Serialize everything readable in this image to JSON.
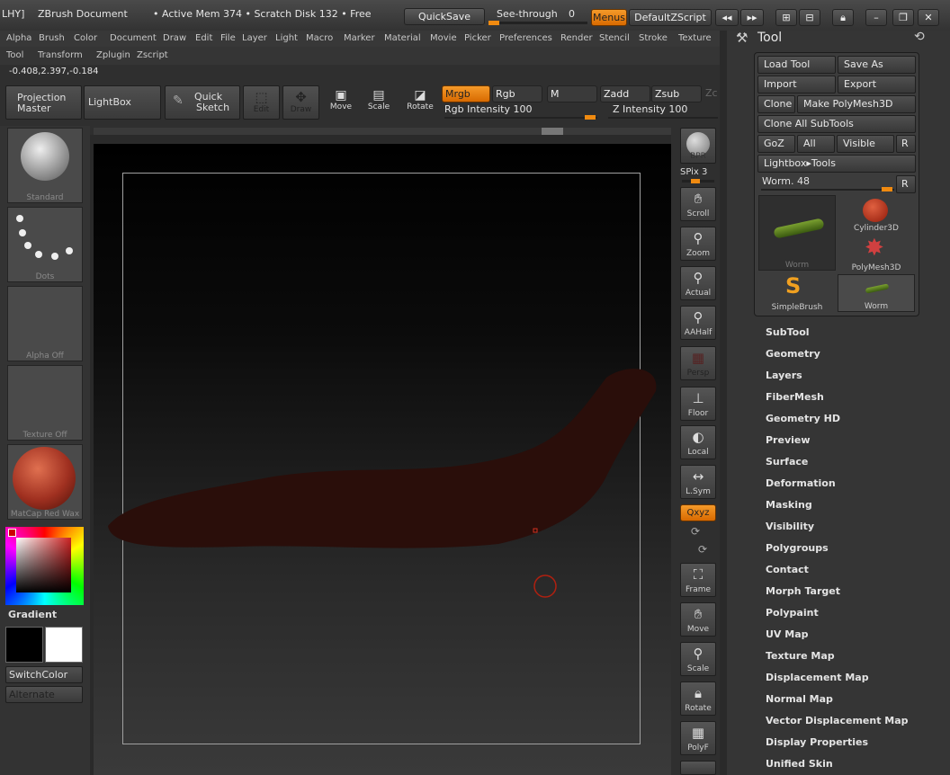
{
  "titlebar": {
    "app": "LHY]",
    "doc": "ZBrush Document",
    "mem": "• Active Mem 374 • Scratch Disk 132 • Free",
    "quicksave": "QuickSave",
    "seethrough": "See-through",
    "seethrough_val": "0",
    "menus": "Menus",
    "script": "DefaultZScript"
  },
  "menu1": [
    "Alpha",
    "Brush",
    "Color",
    "Document",
    "Draw",
    "Edit",
    "File",
    "Layer",
    "Light",
    "Macro",
    "Marker",
    "Material",
    "Movie",
    "Picker",
    "Preferences",
    "Render",
    "Stencil",
    "Stroke",
    "Texture"
  ],
  "menu2": [
    "Tool",
    "Transform",
    "Zplugin",
    "Zscript"
  ],
  "coords": "-0.408,2.397,-0.184",
  "shelf": {
    "projection": "Projection Master",
    "lightbox": "LightBox",
    "quick1": "Quick",
    "quick2": "Sketch",
    "edit": "Edit",
    "draw": "Draw",
    "move": "Move",
    "scale": "Scale",
    "rotate": "Rotate",
    "mrgb": "Mrgb",
    "rgb": "Rgb",
    "m": "M",
    "zadd": "Zadd",
    "zsub": "Zsub",
    "zc": "Zc",
    "rgb_int_label": "Rgb Intensity",
    "rgb_int": "100",
    "z_int_label": "Z Intensity",
    "z_int": "100"
  },
  "left": {
    "brush": "Standard",
    "stroke": "Dots",
    "alpha": "Alpha Off",
    "texture": "Texture Off",
    "material": "MatCap Red Wax",
    "gradient": "Gradient",
    "switch": "SwitchColor",
    "alternate": "Alternate"
  },
  "right_tools": {
    "bpr": "BPR",
    "spix": "SPix 3",
    "scroll": "Scroll",
    "zoom": "Zoom",
    "actual": "Actual",
    "aahalf": "AAHalf",
    "persp": "Persp",
    "floor": "Floor",
    "local": "Local",
    "lsym": "L.Sym",
    "xyz": "Qxyz",
    "frame": "Frame",
    "move": "Move",
    "scale": "Scale",
    "rotate": "Rotate",
    "polyf": "PolyF"
  },
  "tool_panel": {
    "title": "Tool",
    "load": "Load Tool",
    "saveas": "Save As",
    "import": "Import",
    "export": "Export",
    "clone": "Clone",
    "make": "Make PolyMesh3D",
    "cloneall": "Clone All SubTools",
    "goz": "GoZ",
    "all": "All",
    "visible": "Visible",
    "r": "R",
    "lightbox": "Lightbox▸Tools",
    "worm_label": "Worm.",
    "worm_val": "48",
    "r2": "R",
    "thumbs": [
      "Worm",
      "Cylinder3D",
      "PolyMesh3D",
      "SimpleBrush",
      "Worm"
    ]
  },
  "sections": [
    "SubTool",
    "Geometry",
    "Layers",
    "FiberMesh",
    "Geometry HD",
    "Preview",
    "Surface",
    "Deformation",
    "Masking",
    "Visibility",
    "Polygroups",
    "Contact",
    "Morph Target",
    "Polypaint",
    "UV Map",
    "Texture Map",
    "Displacement Map",
    "Normal Map",
    "Vector Displacement Map",
    "Display Properties",
    "Unified Skin"
  ]
}
